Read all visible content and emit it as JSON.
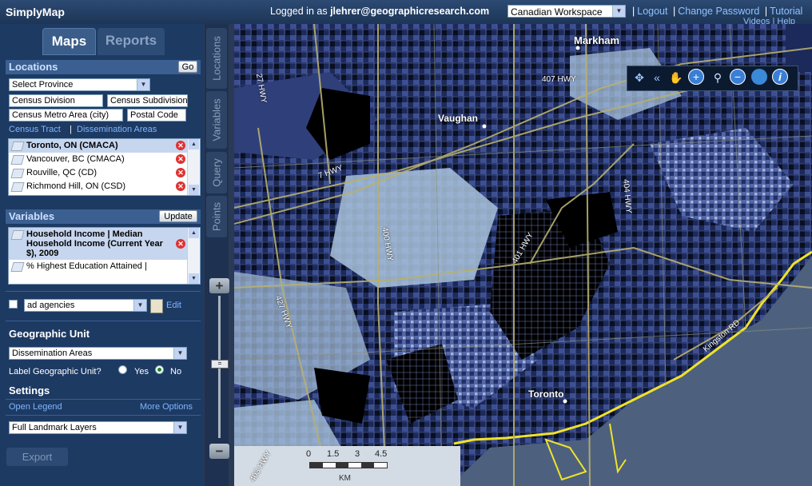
{
  "topbar": {
    "app_title": "SimplyMap",
    "login_prefix": "Logged in as",
    "login_user": "jlehrer@geographicresearch.com",
    "workspace": "Canadian Workspace",
    "links": [
      "Logout",
      "Change Password",
      "Tutorial"
    ],
    "links_row2": "Videos | Help"
  },
  "tabs": {
    "maps": "Maps",
    "reports": "Reports"
  },
  "locations": {
    "heading": "Locations",
    "go": "Go",
    "province_select": "Select Province",
    "buttons": [
      "Census Division",
      "Census Subdivision",
      "Census Metro Area (city)",
      "Postal Code"
    ],
    "link1": "Census Tract",
    "link_sep": "|",
    "link2": "Dissemination Areas",
    "items": [
      "Toronto, ON (CMACA)",
      "Vancouver, BC (CMACA)",
      "Rouville, QC (CD)",
      "Richmond Hill, ON (CSD)"
    ]
  },
  "variables": {
    "heading": "Variables",
    "update": "Update",
    "items": [
      "Household Income | Median Household Income (Current Year $), 2009",
      "% Highest Education Attained | "
    ],
    "filter_value": "ad agencies",
    "edit": "Edit"
  },
  "geo_unit": {
    "heading": "Geographic Unit",
    "select": "Dissemination Areas",
    "label_question": "Label Geographic Unit?",
    "yes": "Yes",
    "no": "No",
    "selected": "No"
  },
  "settings": {
    "heading": "Settings",
    "open_legend": "Open Legend",
    "more_options": "More Options",
    "layers_select": "Full Landmark Layers"
  },
  "export": "Export",
  "vtabs": [
    "Locations",
    "Variables",
    "Query",
    "Points"
  ],
  "map": {
    "labels": {
      "markham": "Markham",
      "vaughan": "Vaughan",
      "toronto": "Toronto",
      "hwy407": "407 HWY",
      "hwy7": "7 HWY",
      "hwy27": "27 HWY",
      "hwy400": "400 HWY",
      "hwy401": "401 HWY",
      "hwy404": "404 HWY",
      "hwy427": "427 HWY",
      "kingston": "Kingston RD",
      "hwy403": "403 HWY"
    },
    "scale": {
      "ticks": [
        "0",
        "1.5",
        "3",
        "4.5"
      ],
      "unit": "KM"
    },
    "colors": {
      "darkest": "#000000",
      "dark": "#1a2a5c",
      "mid": "#4a5a9a",
      "light": "#a9c3dc",
      "water": "#4d617f",
      "shore": "#f0e22a",
      "roads": "#b8b070"
    }
  },
  "zoom": {
    "plus": "+",
    "minus": "−",
    "thumb": "="
  },
  "toolbar_icons": [
    "pan-icon",
    "back-icon",
    "hand-icon",
    "zoom-in-icon",
    "zoom-box-icon",
    "zoom-out-icon",
    "globe-icon",
    "info-icon"
  ]
}
